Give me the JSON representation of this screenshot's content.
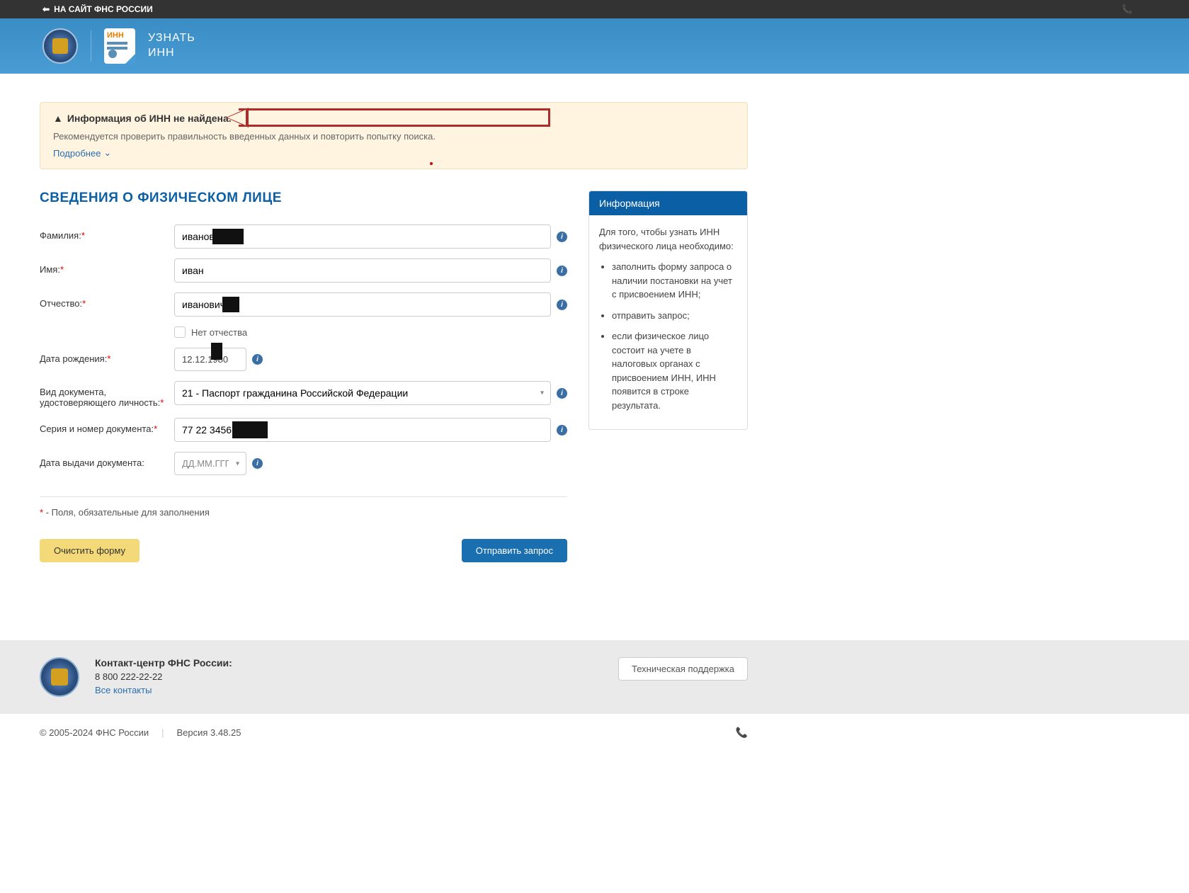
{
  "topbar": {
    "back_label": "НА САЙТ ФНС РОССИИ"
  },
  "header": {
    "title_line1": "УЗНАТЬ",
    "title_line2": "ИНН",
    "doc_label": "ИНН"
  },
  "alert": {
    "heading": "Информация об ИНН не найдена.",
    "recommend": "Рекомендуется проверить правильность введенных данных и повторить попытку поиска.",
    "more_label": "Подробнее"
  },
  "section_title": "СВЕДЕНИЯ О ФИЗИЧЕСКОМ ЛИЦЕ",
  "form": {
    "surname_label": "Фамилия:",
    "surname_value": "иванов",
    "name_label": "Имя:",
    "name_value": "иван",
    "patronymic_label": "Отчество:",
    "patronymic_value": "иванович",
    "no_patronymic": "Нет отчества",
    "birthdate_label": "Дата рождения:",
    "birthdate_value": "12.12.1980",
    "doctype_label": "Вид документа, удостоверяющего личность:",
    "doctype_value": "21 - Паспорт гражданина Российской Федерации",
    "series_label": "Серия и номер документа:",
    "series_value": "77 22 345678",
    "issuedate_label": "Дата выдачи документа:",
    "issuedate_placeholder": "ДД.ММ.ГГГГ"
  },
  "required_note": " - Поля, обязательные для заполнения",
  "buttons": {
    "clear": "Очистить форму",
    "submit": "Отправить запрос"
  },
  "infopanel": {
    "header": "Информация",
    "intro": "Для того, чтобы узнать ИНН физического лица необходимо:",
    "items": [
      "заполнить форму запроса о наличии постановки на учет с присвоением ИНН;",
      "отправить запрос;",
      "если физическое лицо состоит на учете в налоговых органах с присвоением ИНН, ИНН появится в строке результата."
    ]
  },
  "footer": {
    "contact_title": "Контакт-центр ФНС России:",
    "phone": "8 800 222-22-22",
    "all_contacts": "Все контакты",
    "support_btn": "Техническая поддержка",
    "copyright": "© 2005-2024 ФНС России",
    "version": "Версия 3.48.25"
  }
}
